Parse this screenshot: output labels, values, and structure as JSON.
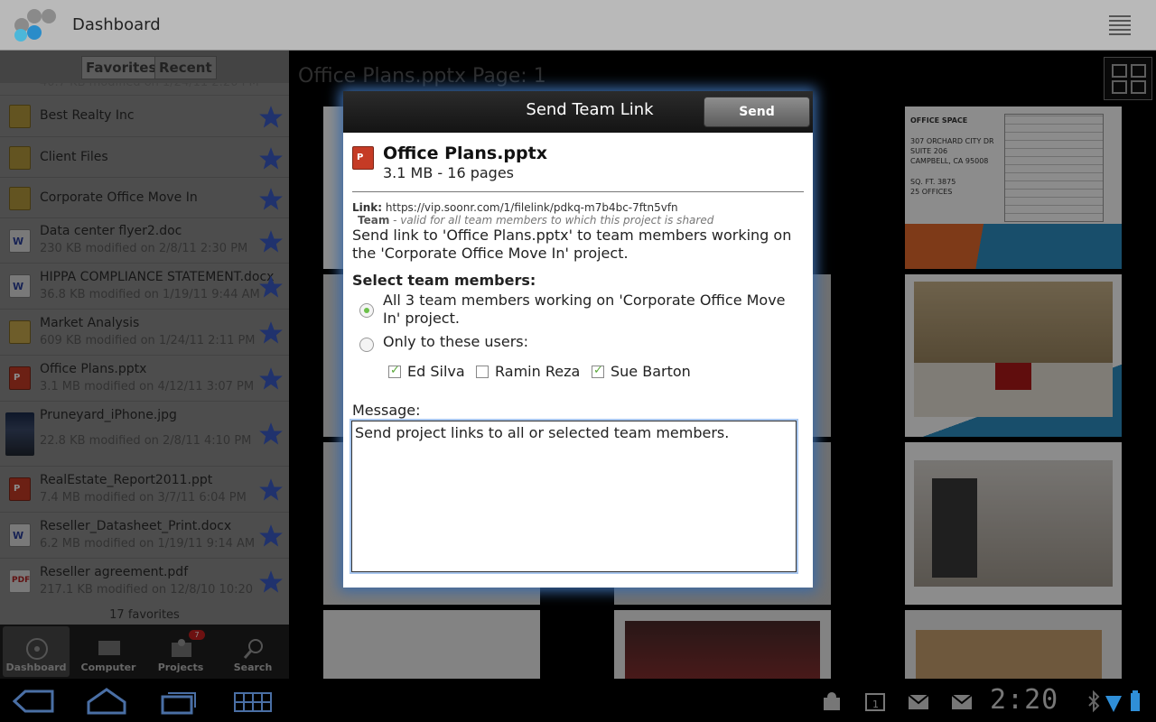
{
  "app": {
    "title": "Dashboard"
  },
  "segments": {
    "favorites": "Favorites",
    "recent": "Recent"
  },
  "files": [
    {
      "name": "Best Realty Inc",
      "meta": "",
      "type": "folder"
    },
    {
      "name": "Client Files",
      "meta": "",
      "type": "folder"
    },
    {
      "name": "Corporate Office Move In",
      "meta": "",
      "type": "folder"
    },
    {
      "name": "Data center flyer2.doc",
      "meta": "230 KB modified on 2/8/11 2:30 PM",
      "type": "doc"
    },
    {
      "name": "HIPPA COMPLIANCE STATEMENT.docx",
      "meta": "36.8 KB modified on 1/19/11 9:44 AM",
      "type": "doc"
    },
    {
      "name": "Market Analysis",
      "meta": "609 KB modified on 1/24/11 2:11 PM",
      "type": "folder"
    },
    {
      "name": "Office Plans.pptx",
      "meta": "3.1 MB modified on 4/12/11 3:07 PM",
      "type": "ppt"
    },
    {
      "name": "Pruneyard_iPhone.jpg",
      "meta": "22.8 KB modified on 2/8/11 4:10 PM",
      "type": "img"
    },
    {
      "name": "RealEstate_Report2011.ppt",
      "meta": "7.4 MB modified on 3/7/11 6:04 PM",
      "type": "ppt"
    },
    {
      "name": "Reseller_Datasheet_Print.docx",
      "meta": "6.2 MB modified on 1/19/11 9:14 AM",
      "type": "doc"
    },
    {
      "name": "Reseller agreement.pdf",
      "meta": "217.1 KB modified on 12/8/10 10:20",
      "type": "pdf"
    }
  ],
  "favorites_count": "17 favorites",
  "tabs": [
    {
      "label": "Dashboard",
      "icon": "dashboard-icon"
    },
    {
      "label": "Computer",
      "icon": "computer-icon"
    },
    {
      "label": "Projects",
      "icon": "projects-icon",
      "badge": "7"
    },
    {
      "label": "Search",
      "icon": "search-icon"
    }
  ],
  "viewer": {
    "page_title": "Office Plans.pptx Page: 1"
  },
  "thumbs": {
    "office_space_lines": [
      "OFFICE SPACE",
      "307 ORCHARD CITY DR",
      "SUITE 206",
      "CAMPBELL, CA 95008",
      "SQ. FT. 3875",
      "25 OFFICES"
    ]
  },
  "dialog": {
    "title": "Send Team Link",
    "send_label": "Send",
    "file_name": "Office Plans.pptx",
    "file_size": "3.1 MB - 16 pages",
    "link_label": "Link:",
    "link_url": "https://vip.soonr.com/1/filelink/pdkq-m7b4bc-7ftn5vfn",
    "team_label": "Team",
    "team_note": " - valid for all team members to which this project is shared",
    "description": "Send link to 'Office Plans.pptx' to team members working on the 'Corporate Office Move In' project.",
    "select_header": "Select team members:",
    "option_all": "All 3 team members working on 'Corporate Office Move In' project.",
    "option_only": "Only to these users:",
    "members": [
      {
        "name": "Ed Silva",
        "checked": true
      },
      {
        "name": "Ramin Reza",
        "checked": false
      },
      {
        "name": "Sue Barton",
        "checked": true
      }
    ],
    "message_label": "Message:",
    "message_value": "Send project links to all or selected team members."
  },
  "status": {
    "clock": "2:20"
  },
  "colors": {
    "accent_blue": "#3a6aa8",
    "star": "#3b5cc6",
    "radio_on": "#6cc04a"
  }
}
